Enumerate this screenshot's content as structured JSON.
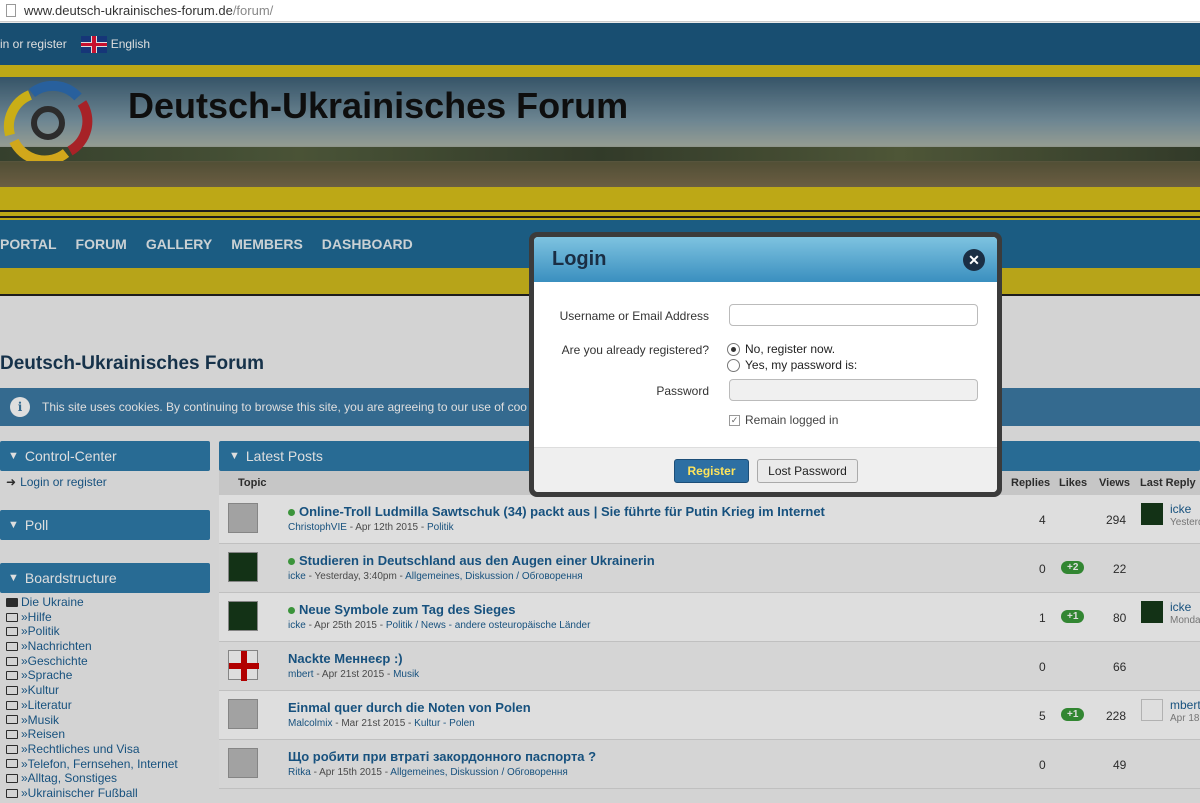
{
  "browser": {
    "url_host": "www.deutsch-ukrainisches-forum.de",
    "url_path": "/forum/"
  },
  "topbar": {
    "login": "in or register",
    "language": "English"
  },
  "site": {
    "title": "Deutsch-Ukrainisches Forum"
  },
  "nav": [
    "PORTAL",
    "FORUM",
    "GALLERY",
    "MEMBERS",
    "DASHBOARD"
  ],
  "page_title": "Deutsch-Ukrainisches Forum",
  "notice": "This site uses cookies. By continuing to browse this site, you are agreeing to our use of coo",
  "sidebar": {
    "control_center": "Control-Center",
    "login_link": "Login or register",
    "poll": "Poll",
    "boardstructure": "Boardstructure",
    "boards": [
      "Die Ukraine",
      "»Hilfe",
      "»Politik",
      "»Nachrichten",
      "»Geschichte",
      "»Sprache",
      "»Kultur",
      "»Literatur",
      "»Musik",
      "»Reisen",
      "»Rechtliches und Visa",
      "»Telefon, Fernsehen, Internet",
      "»Alltag, Sonstiges",
      "»Ukrainischer Fußball"
    ]
  },
  "latest": {
    "heading": "Latest Posts",
    "columns": {
      "topic": "Topic",
      "replies": "Replies",
      "likes": "Likes",
      "views": "Views",
      "last_reply": "Last Reply"
    },
    "rows": [
      {
        "title": "Online-Troll Ludmilla Sawtschuk (34) packt aus | Sie führte für Putin Krieg im Internet",
        "author": "ChristophVIE",
        "date": " - Apr 12th 2015 - ",
        "board": "Politik",
        "replies": "4",
        "likes": "",
        "views": "294",
        "last_name": "icke",
        "last_sub": "Yesterd"
      },
      {
        "title": "Studieren in Deutschland aus den Augen einer Ukrainerin",
        "author": "icke",
        "date": " - Yesterday, 3:40pm - ",
        "board": "Allgemeines, Diskussion / Обговорення",
        "replies": "0",
        "likes": "+2",
        "views": "22",
        "last_name": "",
        "last_sub": ""
      },
      {
        "title": "Neue Symbole zum Tag des Sieges",
        "author": "icke",
        "date": " - Apr 25th 2015 - ",
        "board": "Politik / News - andere osteuropäische Länder",
        "replies": "1",
        "likes": "+1",
        "views": "80",
        "last_name": "icke",
        "last_sub": "Monda"
      },
      {
        "title": "Nackte Меннеєр :)",
        "author": "mbert",
        "date": " - Apr 21st 2015 - ",
        "board": "Musik",
        "replies": "0",
        "likes": "",
        "views": "66",
        "last_name": "",
        "last_sub": ""
      },
      {
        "title": "Einmal quer durch die Noten von Polen",
        "author": "Malcolmix",
        "date": " - Mar 21st 2015 - ",
        "board": "Kultur - Polen",
        "replies": "5",
        "likes": "+1",
        "views": "228",
        "last_name": "mbert",
        "last_sub": "Apr 18"
      },
      {
        "title": "Що робити при втраті закордонного паспорта ?",
        "author": "Ritka",
        "date": " - Apr 15th 2015 - ",
        "board": "Allgemeines, Diskussion / Обговорення",
        "replies": "0",
        "likes": "",
        "views": "49",
        "last_name": "",
        "last_sub": ""
      }
    ]
  },
  "modal": {
    "title": "Login",
    "username_label": "Username or Email Address",
    "registered_label": "Are you already registered?",
    "opt_no": "No, register now.",
    "opt_yes": "Yes, my password is:",
    "password_label": "Password",
    "remember": "Remain logged in",
    "register_btn": "Register",
    "lost_btn": "Lost Password"
  }
}
